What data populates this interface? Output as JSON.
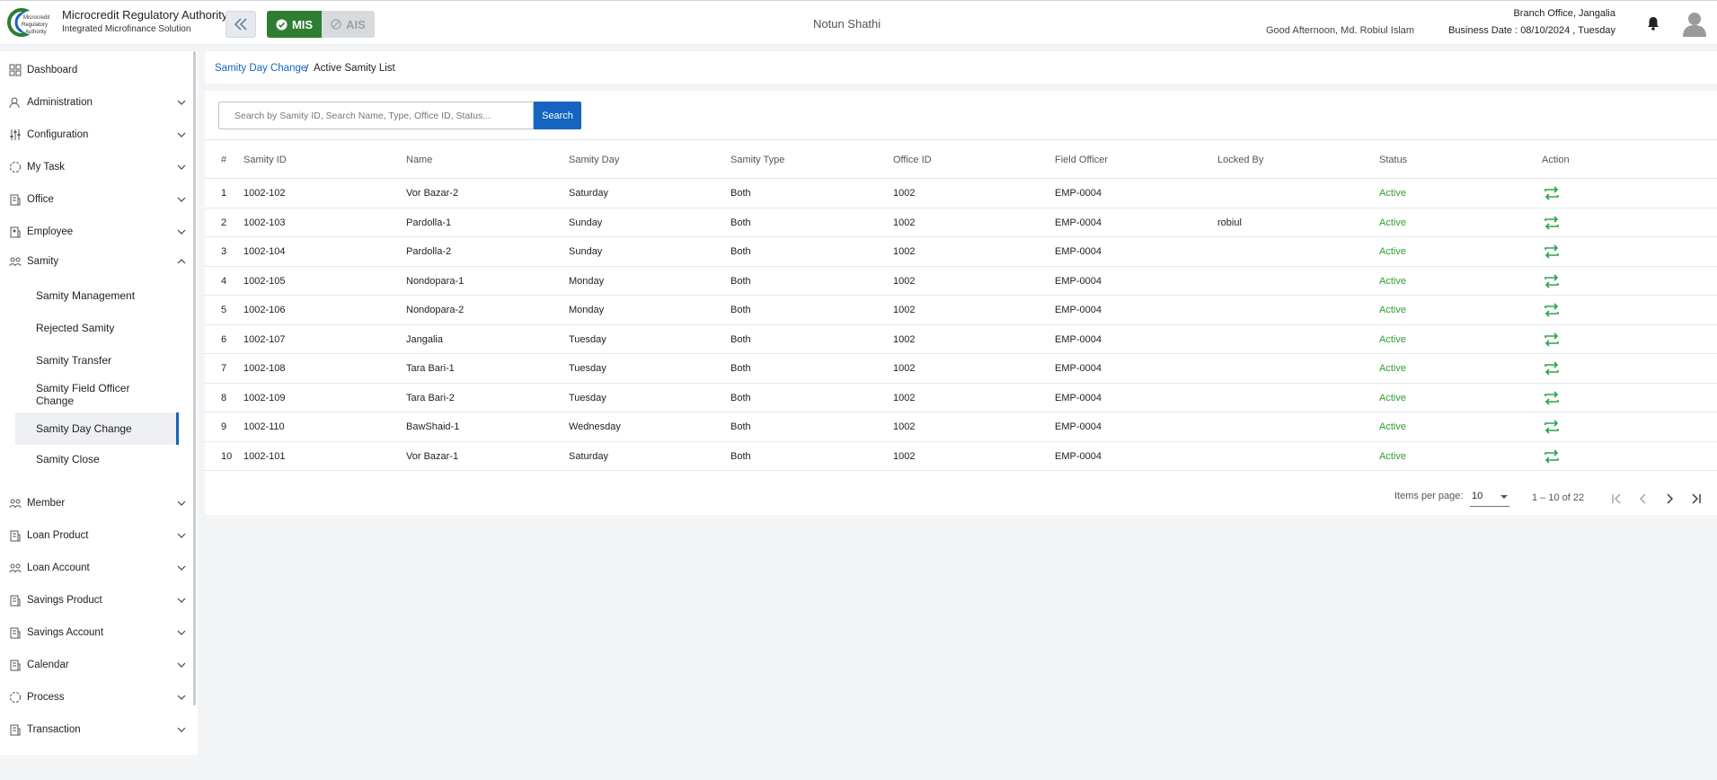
{
  "header": {
    "org_name": "Microcredit Regulatory Authority",
    "org_subtitle": "Integrated Microfinance Solution",
    "logo_text": "Microcredit Regulatory Authority",
    "mode_mis": "MIS",
    "mode_ais": "AIS",
    "app_name": "Notun Shathi",
    "greeting": "Good Afternoon, Md. Robiul Islam",
    "branch": "Branch Office, Jangalia",
    "business_date": "Business Date : 08/10/2024 , Tuesday"
  },
  "sidebar": {
    "items": [
      {
        "label": "Dashboard",
        "icon": "dashboard-icon"
      },
      {
        "label": "Administration",
        "icon": "admin-icon"
      },
      {
        "label": "Configuration",
        "icon": "sliders-icon"
      },
      {
        "label": "My Task",
        "icon": "task-icon"
      },
      {
        "label": "Office",
        "icon": "building-icon"
      },
      {
        "label": "Employee",
        "icon": "employee-icon"
      },
      {
        "label": "Samity",
        "icon": "group-icon"
      },
      {
        "label": "Member",
        "icon": "member-icon"
      },
      {
        "label": "Loan Product",
        "icon": "loan-product-icon"
      },
      {
        "label": "Loan Account",
        "icon": "loan-account-icon"
      },
      {
        "label": "Savings Product",
        "icon": "savings-product-icon"
      },
      {
        "label": "Savings Account",
        "icon": "savings-account-icon"
      },
      {
        "label": "Calendar",
        "icon": "calendar-icon"
      },
      {
        "label": "Process",
        "icon": "process-icon"
      },
      {
        "label": "Transaction",
        "icon": "transaction-icon"
      }
    ],
    "samity_sub": [
      {
        "label": "Samity Management"
      },
      {
        "label": "Rejected Samity"
      },
      {
        "label": "Samity Transfer"
      },
      {
        "label": "Samity Field Officer Change"
      },
      {
        "label": "Samity Day Change"
      },
      {
        "label": "Samity Close"
      }
    ]
  },
  "breadcrumb": {
    "parent": "Samity Day Change",
    "separator": "/",
    "current": "Active Samity List"
  },
  "search": {
    "placeholder": "Search by Samity ID, Search Name, Type, Office ID, Status...",
    "button": "Search"
  },
  "table": {
    "columns": [
      "#",
      "Samity ID",
      "Name",
      "Samity Day",
      "Samity Type",
      "Office ID",
      "Field Officer",
      "Locked By",
      "Status",
      "Action"
    ],
    "rows": [
      {
        "n": "1",
        "id": "1002-102",
        "name": "Vor Bazar-2",
        "day": "Saturday",
        "type": "Both",
        "office": "1002",
        "officer": "EMP-0004",
        "locked": "",
        "status": "Active"
      },
      {
        "n": "2",
        "id": "1002-103",
        "name": "Pardolla-1",
        "day": "Sunday",
        "type": "Both",
        "office": "1002",
        "officer": "EMP-0004",
        "locked": "robiul",
        "status": "Active"
      },
      {
        "n": "3",
        "id": "1002-104",
        "name": "Pardolla-2",
        "day": "Sunday",
        "type": "Both",
        "office": "1002",
        "officer": "EMP-0004",
        "locked": "",
        "status": "Active"
      },
      {
        "n": "4",
        "id": "1002-105",
        "name": "Nondopara-1",
        "day": "Monday",
        "type": "Both",
        "office": "1002",
        "officer": "EMP-0004",
        "locked": "",
        "status": "Active"
      },
      {
        "n": "5",
        "id": "1002-106",
        "name": "Nondopara-2",
        "day": "Monday",
        "type": "Both",
        "office": "1002",
        "officer": "EMP-0004",
        "locked": "",
        "status": "Active"
      },
      {
        "n": "6",
        "id": "1002-107",
        "name": "Jangalia",
        "day": "Tuesday",
        "type": "Both",
        "office": "1002",
        "officer": "EMP-0004",
        "locked": "",
        "status": "Active"
      },
      {
        "n": "7",
        "id": "1002-108",
        "name": "Tara Bari-1",
        "day": "Tuesday",
        "type": "Both",
        "office": "1002",
        "officer": "EMP-0004",
        "locked": "",
        "status": "Active"
      },
      {
        "n": "8",
        "id": "1002-109",
        "name": "Tara Bari-2",
        "day": "Tuesday",
        "type": "Both",
        "office": "1002",
        "officer": "EMP-0004",
        "locked": "",
        "status": "Active"
      },
      {
        "n": "9",
        "id": "1002-110",
        "name": "BawShaid-1",
        "day": "Wednesday",
        "type": "Both",
        "office": "1002",
        "officer": "EMP-0004",
        "locked": "",
        "status": "Active"
      },
      {
        "n": "10",
        "id": "1002-101",
        "name": "Vor Bazar-1",
        "day": "Saturday",
        "type": "Both",
        "office": "1002",
        "officer": "EMP-0004",
        "locked": "",
        "status": "Active"
      }
    ]
  },
  "pagination": {
    "items_per_page_label": "Items per page:",
    "items_per_page": "10",
    "range": "1 – 10 of 22"
  },
  "colors": {
    "primary": "#1565c0",
    "mis_green": "#2e7d32",
    "status_active": "#2e9e2e",
    "action_icon": "#2aa34a"
  }
}
